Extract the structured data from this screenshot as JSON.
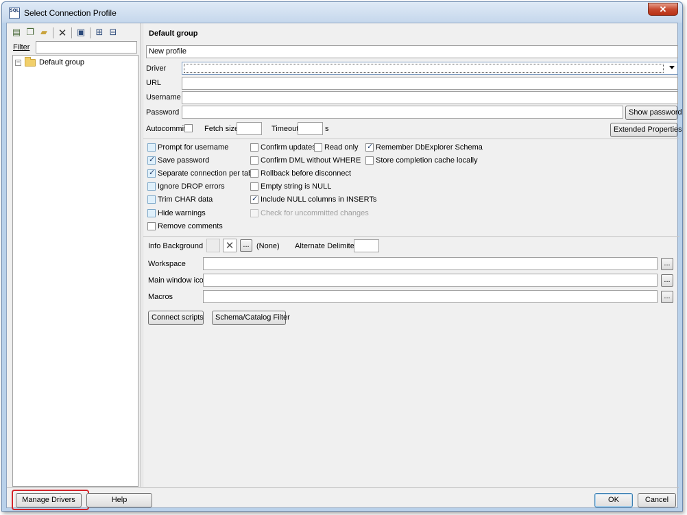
{
  "window": {
    "title": "Select Connection Profile",
    "app_icon_text": "SQL",
    "close_glyph": "✕"
  },
  "toolbar": {
    "icons": [
      "new-profile-icon",
      "copy-profile-icon",
      "new-folder-icon",
      "delete-icon",
      "save-icon",
      "expand-all-icon",
      "collapse-all-icon"
    ],
    "delete_glyph": "✕"
  },
  "left": {
    "filter_label": "Filter",
    "filter_value": "",
    "tree": [
      {
        "label": "Default group",
        "expanded": true
      }
    ]
  },
  "profile": {
    "group_title": "Default group",
    "name": "New profile",
    "driver_label": "Driver",
    "driver_value": "",
    "url_label": "URL",
    "url_value": "",
    "username_label": "Username",
    "username_value": "",
    "password_label": "Password",
    "password_value": "",
    "show_password": "Show password",
    "autocommit_label": "Autocommit",
    "fetch_size_label": "Fetch size",
    "fetch_size_value": "",
    "timeout_label": "Timeout",
    "timeout_value": "",
    "timeout_unit": "s",
    "extended_properties": "Extended Properties"
  },
  "options": {
    "col1": [
      {
        "label": "Prompt for username",
        "checked": false
      },
      {
        "label": "Save password",
        "checked": true
      },
      {
        "label": "Separate connection per tab",
        "checked": true
      },
      {
        "label": "Ignore DROP errors",
        "checked": false
      },
      {
        "label": "Trim CHAR data",
        "checked": false
      },
      {
        "label": "Hide warnings",
        "checked": false
      },
      {
        "label": "Remove comments",
        "checked": false
      }
    ],
    "col2": [
      {
        "label": "Confirm updates",
        "checked": false
      },
      {
        "label": "Confirm DML without WHERE",
        "checked": false
      },
      {
        "label": "Rollback before disconnect",
        "checked": false
      },
      {
        "label": "Empty string is NULL",
        "checked": false
      },
      {
        "label": "Include NULL columns in INSERTs",
        "checked": true
      },
      {
        "label": "Check for uncommitted changes",
        "checked": false,
        "disabled": true
      }
    ],
    "read_only": {
      "label": "Read only",
      "checked": false
    },
    "col3": [
      {
        "label": "Remember DbExplorer Schema",
        "checked": true
      },
      {
        "label": "Store completion cache locally",
        "checked": false
      }
    ]
  },
  "extras": {
    "info_background_label": "Info Background",
    "info_background_value": "(None)",
    "clear_glyph": "✕",
    "ellipsis": "...",
    "alternate_delimiter_label": "Alternate Delimiter",
    "alternate_delimiter_value": "",
    "workspace_label": "Workspace",
    "workspace_value": "",
    "main_window_icon_label": "Main window icon",
    "main_window_icon_value": "",
    "macros_label": "Macros",
    "macros_value": "",
    "connect_scripts": "Connect scripts",
    "schema_catalog_filter": "Schema/Catalog Filter"
  },
  "bottom": {
    "manage_drivers": "Manage Drivers",
    "help": "Help",
    "ok": "OK",
    "cancel": "Cancel",
    "highlight_color": "#d4242a"
  }
}
